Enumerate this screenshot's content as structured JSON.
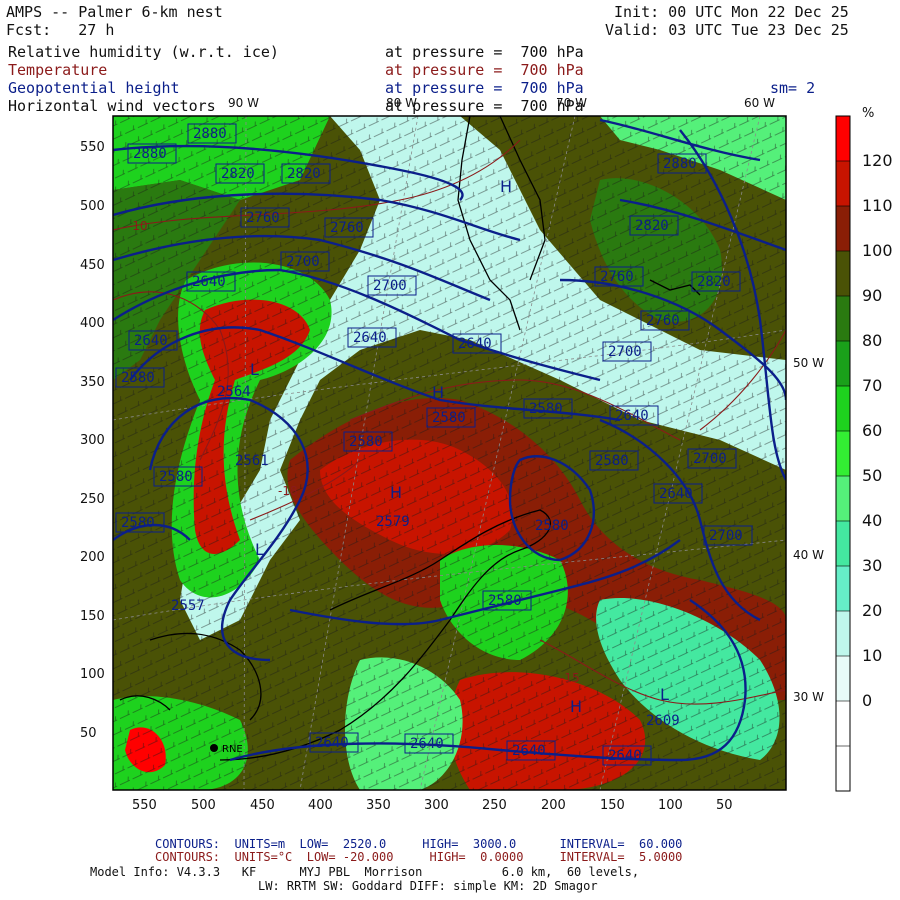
{
  "header": {
    "model_title": "AMPS -- Palmer 6-km nest",
    "forecast": "Fcst:   27 h",
    "init": "Init: 00 UTC Mon 22 Dec 25",
    "valid": "Valid: 03 UTC Tue 23 Dec 25",
    "smoothing": "sm= 2"
  },
  "fields": [
    {
      "name": "Relative humidity (w.r.t. ice)",
      "level": "at pressure =  700 hPa",
      "color": "#111111"
    },
    {
      "name": "Temperature",
      "level": "at pressure =  700 hPa",
      "color": "#8b1a1a"
    },
    {
      "name": "Geopotential height",
      "level": "at pressure =  700 hPa",
      "color": "#0b1f8a"
    },
    {
      "name": "Horizontal wind vectors",
      "level": "at pressure =  700 hPa",
      "color": "#111111"
    }
  ],
  "axes": {
    "y_ticks": [
      550,
      500,
      450,
      400,
      350,
      300,
      250,
      200,
      150,
      100,
      50
    ],
    "x_ticks": [
      550,
      500,
      450,
      400,
      350,
      300,
      250,
      200,
      150,
      100,
      50
    ],
    "top_lon_labels": [
      "90 W",
      "80 W",
      "70 W",
      "60 W"
    ],
    "right_lon_labels": [
      "50 W",
      "40 W",
      "30 W"
    ]
  },
  "colorbar": {
    "unit": "%",
    "labels": [
      120,
      110,
      100,
      90,
      80,
      70,
      60,
      50,
      40,
      30,
      20,
      10,
      0
    ],
    "colors": [
      "#ff0000",
      "#c81400",
      "#8a1e06",
      "#4a5206",
      "#2a7a10",
      "#1aa01a",
      "#1ed21e",
      "#33ee33",
      "#55f07a",
      "#44e8a0",
      "#66eec8",
      "#bff7ec",
      "#e8fbf8",
      "#ffffff",
      "#ffffff"
    ]
  },
  "map": {
    "height_labels": [
      "2880",
      "2880",
      "2820",
      "2820",
      "2760",
      "2760",
      "2700",
      "2700",
      "2640",
      "2640",
      "2640",
      "2640",
      "2580",
      "2580",
      "2580",
      "2580",
      "2580",
      "2580",
      "2580",
      "2640",
      "2640",
      "2700",
      "2700",
      "2760",
      "2820",
      "2880",
      "2820",
      "2760",
      "2700",
      "2640",
      "2640",
      "2580",
      "2640",
      "2640"
    ],
    "cell_labels": [
      "2564",
      "2561",
      "2579",
      "2557",
      "2609",
      "2580"
    ],
    "temp_labels": [
      "-10",
      "-18",
      "-15"
    ],
    "highs": [
      "H",
      "H",
      "H",
      "H"
    ],
    "lows": [
      "L",
      "L",
      "L"
    ],
    "station_label": "RNE"
  },
  "footer": {
    "contours_blue": "CONTOURS:  UNITS=m  LOW=  2520.0     HIGH=  3000.0      INTERVAL=  60.000",
    "contours_red": "CONTOURS:  UNITS=°C  LOW= -20.000     HIGH=  0.0000     INTERVAL=  5.0000",
    "model_info": "Model Info: V4.3.3   KF      MYJ PBL  Morrison           6.0 km,  60 levels,",
    "physics": "LW: RRTM SW: Goddard DIFF: simple KM: 2D Smagor"
  }
}
